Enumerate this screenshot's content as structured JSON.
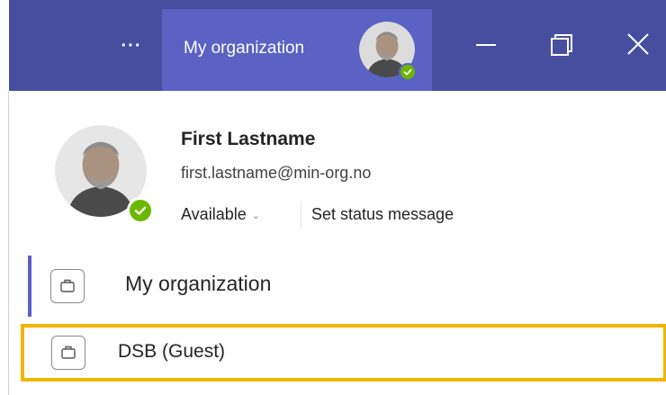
{
  "titlebar": {
    "more_label": "···",
    "org_tab_label": "My organization",
    "colors": {
      "bar": "#464ea0",
      "tab": "#5a62c4",
      "presence": "#6bb700"
    }
  },
  "window_controls": [
    "minimize-icon",
    "maximize-icon",
    "close-icon"
  ],
  "profile": {
    "name": "First Lastname",
    "email": "first.lastname@min-org.no",
    "status": "Available",
    "set_status": "Set status message"
  },
  "accounts": [
    {
      "label": "My organization",
      "icon": "briefcase-icon",
      "active": true
    },
    {
      "label": "DSB (Guest)",
      "icon": "briefcase-icon",
      "highlighted": true,
      "highlight_color": "#f2b400"
    }
  ]
}
